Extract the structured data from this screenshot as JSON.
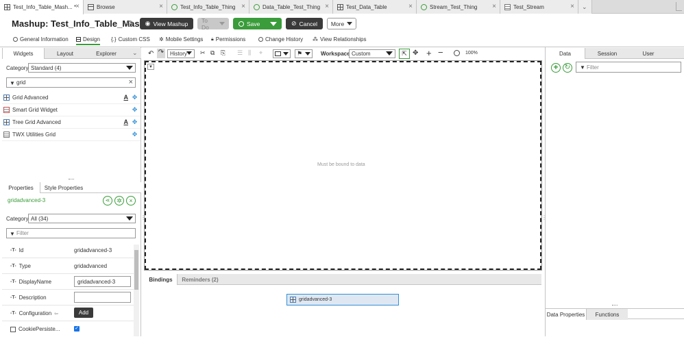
{
  "tabs": [
    {
      "label": "Test_Info_Table_Mash... *",
      "icon": "grid-icon",
      "active": true
    },
    {
      "label": "Browse",
      "icon": "browse-icon",
      "active": false
    },
    {
      "label": "Test_Info_Table_Thing",
      "icon": "thing-icon",
      "active": false
    },
    {
      "label": "Data_Table_Test_Thing",
      "icon": "thing-icon",
      "active": false
    },
    {
      "label": "Test_Data_Table",
      "icon": "table-icon",
      "active": false
    },
    {
      "label": "Stream_Test_Thing",
      "icon": "thing-icon",
      "active": false
    },
    {
      "label": "Test_Stream",
      "icon": "stream-icon",
      "active": false
    }
  ],
  "header": {
    "title": "Mashup: Test_Info_Table_Mashup *",
    "view_mashup": "View Mashup",
    "todo": "To Do",
    "save": "Save",
    "cancel": "Cancel",
    "more": "More"
  },
  "subnav": [
    "General Information",
    "Design",
    "Custom CSS",
    "Mobile Settings",
    "Permissions",
    "Change History",
    "View Relationships"
  ],
  "left_tabs": [
    "Widgets",
    "Layout",
    "Explorer"
  ],
  "widgets": {
    "category_label": "Category",
    "category_value": "Standard (4)",
    "search_value": "grid",
    "items": [
      "Grid Advanced",
      "Smart Grid Widget",
      "Tree Grid Advanced",
      "TWX Utilities Grid"
    ]
  },
  "properties": {
    "tabs": [
      "Properties",
      "Style Properties"
    ],
    "widget_id": "gridadvanced-3",
    "category_label": "Category",
    "category_value": "All (34)",
    "filter_placeholder": "Filter",
    "rows": [
      {
        "label": "Id",
        "value": "gridadvanced-3"
      },
      {
        "label": "Type",
        "value": "gridadvanced"
      },
      {
        "label": "DisplayName",
        "value": "gridadvanced-3"
      },
      {
        "label": "Description",
        "value": ""
      },
      {
        "label": "Configuration",
        "value": "Add"
      },
      {
        "label": "CookiePersiste...",
        "value": ""
      }
    ]
  },
  "toolbar": {
    "history": "History",
    "workspace_label": "Workspace",
    "workspace_value": "Custom",
    "zoom": "100%"
  },
  "canvas": {
    "placeholder": "Must be bound to data"
  },
  "bottom": {
    "tabs": [
      "Bindings",
      "Reminders (2)"
    ],
    "binding_node": "gridadvanced-3"
  },
  "right": {
    "tabs": [
      "Data",
      "Session",
      "User"
    ],
    "filter_placeholder": "Filter",
    "bottom_tabs": [
      "Data Properties",
      "Functions"
    ]
  },
  "colors": {
    "accent": "#3a9c3a",
    "dark_button": "#3a3a3a",
    "selection_blue": "#2f8fd8"
  }
}
